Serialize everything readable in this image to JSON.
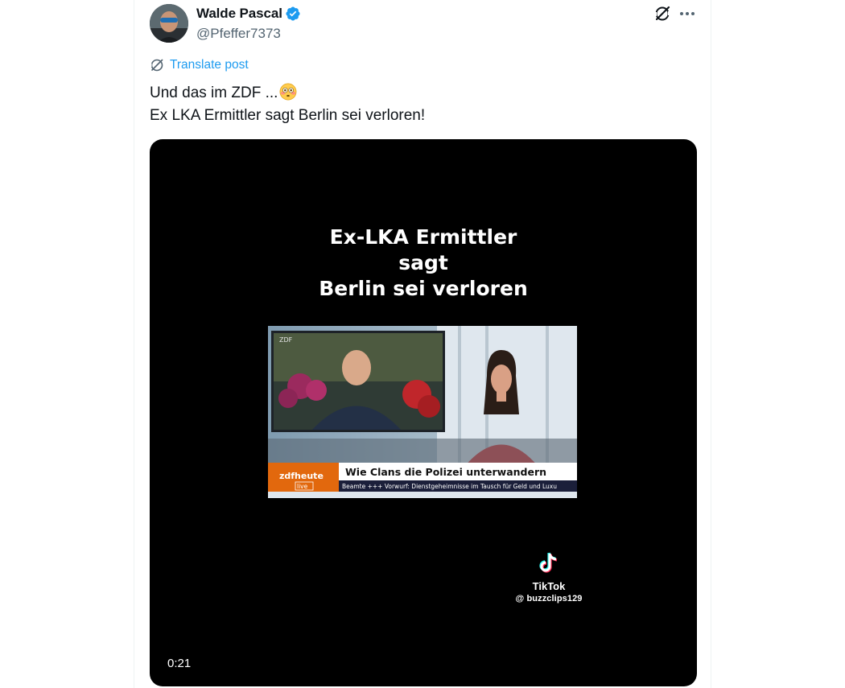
{
  "author": {
    "display_name": "Walde Pascal",
    "handle": "@Pfeffer7373",
    "verified": true,
    "avatar_icon": "user-avatar"
  },
  "actions": {
    "grok_icon": "grok-icon",
    "more_icon": "more-options-icon"
  },
  "translate": {
    "label": "Translate post",
    "icon": "translate-globe-icon"
  },
  "post": {
    "line1": "Und das im ZDF ...",
    "line1_emoji": "flushed-face",
    "line2": "Ex LKA Ermittler sagt Berlin sei verloren!"
  },
  "video": {
    "title_lines": [
      "Ex-LKA Ermittler",
      "sagt",
      "Berlin sei verloren"
    ],
    "embedded_frame": {
      "channel_logo": "ZDF",
      "brand": "zdfheute",
      "brand_live": "live",
      "headline": "Wie Clans die Polizei unterwandern",
      "ticker": "Beamte +++ Vorwurf: Dienstgeheimnisse im Tausch für Geld und Luxu"
    },
    "watermark": {
      "app": "TikTok",
      "user": "@ buzzclips129"
    },
    "duration": "0:21"
  },
  "colors": {
    "accent": "#1d9bf0",
    "text": "#0f1419",
    "muted": "#536471",
    "media_bg": "#000000"
  }
}
